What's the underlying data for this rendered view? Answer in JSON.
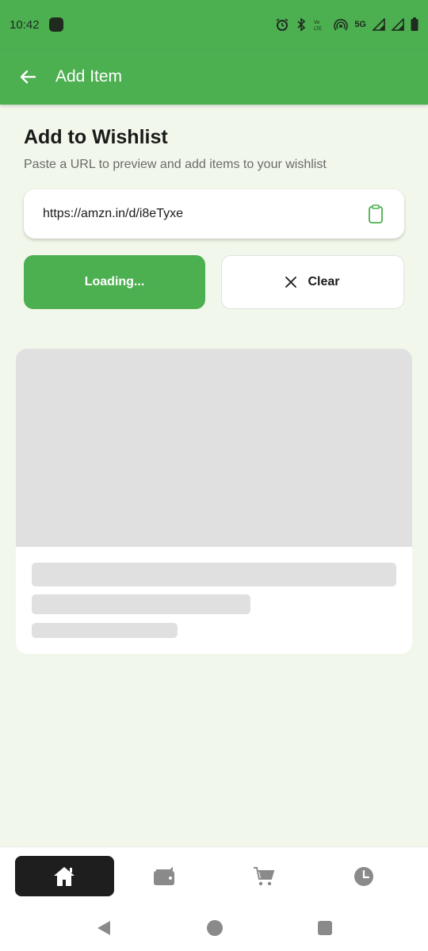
{
  "status_bar": {
    "time": "10:42",
    "network": "5G"
  },
  "app_bar": {
    "title": "Add Item",
    "back_icon": "arrow-left-icon"
  },
  "page": {
    "heading": "Add to Wishlist",
    "subheading": "Paste a URL to preview and add items to your wishlist"
  },
  "url_field": {
    "value": "https://amzn.in/d/i8eTyxe",
    "icon": "clipboard-icon"
  },
  "buttons": {
    "primary_label": "Loading...",
    "clear_label": "Clear"
  },
  "bottom_nav": {
    "items": [
      {
        "icon": "home-icon",
        "active": true
      },
      {
        "icon": "wallet-icon",
        "active": false
      },
      {
        "icon": "cart-icon",
        "active": false
      },
      {
        "icon": "clock-icon",
        "active": false
      }
    ]
  },
  "colors": {
    "primary": "#4caf50",
    "background": "#f1f7ea",
    "skeleton": "#e0e0e0",
    "nav_active": "#1e1e1e"
  }
}
